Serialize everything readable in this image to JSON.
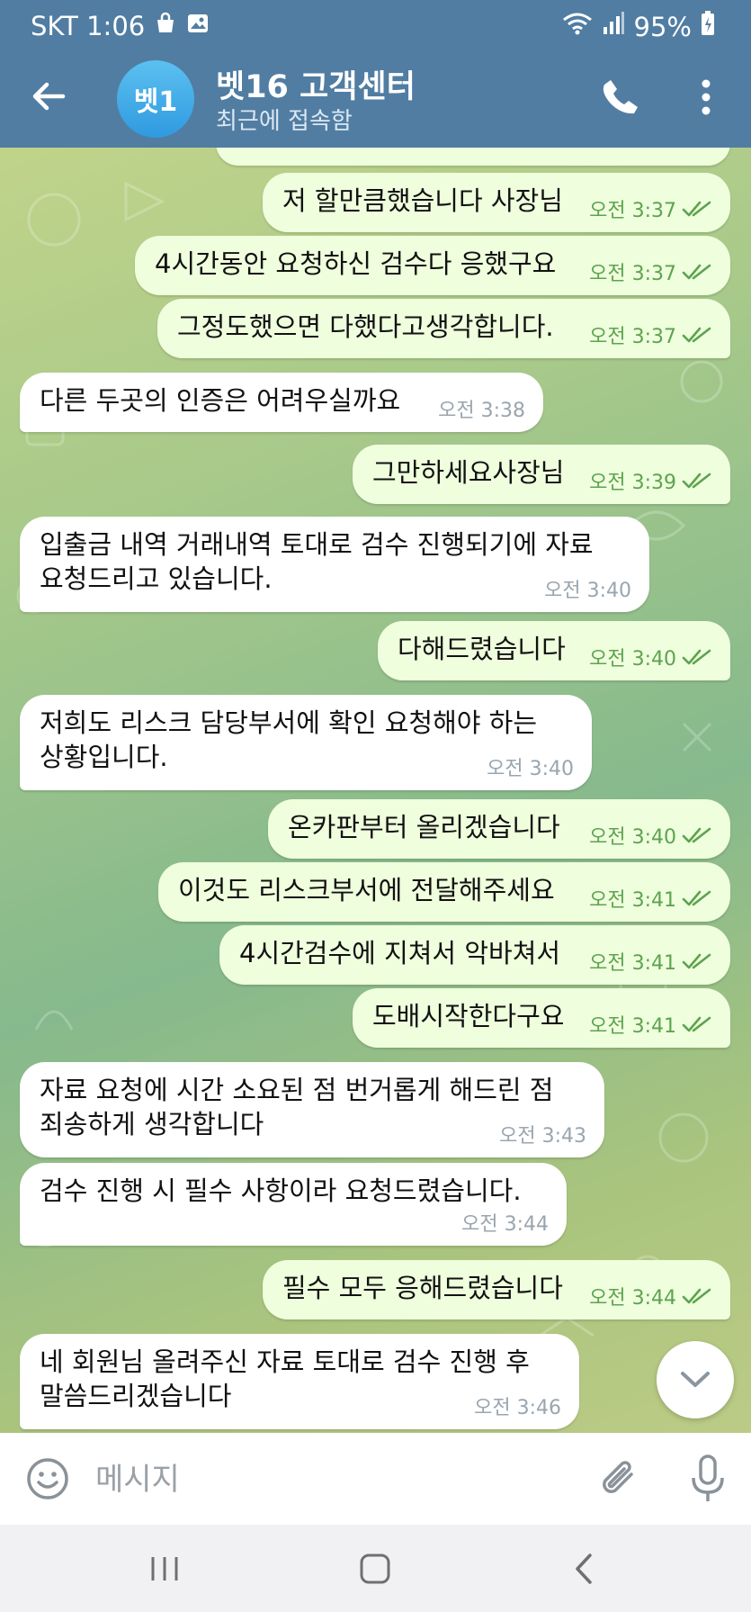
{
  "status_bar": {
    "carrier_time": "SKT 1:06",
    "battery": "95%"
  },
  "header": {
    "avatar_text": "벳1",
    "title": "벳16 고객센터",
    "subtitle": "최근에 접속함"
  },
  "messages": [
    {
      "dir": "out",
      "text": "저 할만큼했습니다 사장님",
      "time": "오전 3:37"
    },
    {
      "dir": "out",
      "text": "4시간동안 요청하신 검수다 응했구요",
      "time": "오전 3:37"
    },
    {
      "dir": "out",
      "text": "그정도했으면 다했다고생각합니다.",
      "time": "오전 3:37"
    },
    {
      "dir": "in",
      "text": "다른 두곳의 인증은 어려우실까요",
      "time": "오전 3:38"
    },
    {
      "dir": "out",
      "text": "그만하세요사장님",
      "time": "오전 3:39"
    },
    {
      "dir": "in",
      "text": "입출금 내역 거래내역 토대로 검수 진행되기에 자료\n요청드리고 있습니다.",
      "time": "오전 3:40"
    },
    {
      "dir": "out",
      "text": "다해드렸습니다",
      "time": "오전 3:40"
    },
    {
      "dir": "in",
      "text": "저희도 리스크 담당부서에 확인 요청해야 하는\n상황입니다.",
      "time": "오전 3:40"
    },
    {
      "dir": "out",
      "text": "온카판부터 올리겠습니다",
      "time": "오전 3:40"
    },
    {
      "dir": "out",
      "text": "이것도 리스크부서에 전달해주세요",
      "time": "오전 3:41"
    },
    {
      "dir": "out",
      "text": "4시간검수에 지쳐서 악바쳐서",
      "time": "오전 3:41"
    },
    {
      "dir": "out",
      "text": "도배시작한다구요",
      "time": "오전 3:41"
    },
    {
      "dir": "in",
      "text": "자료 요청에 시간 소요된 점 번거롭게 해드린 점\n죄송하게 생각합니다",
      "time": "오전 3:43"
    },
    {
      "dir": "in",
      "text": "검수 진행 시 필수 사항이라 요청드렸습니다.",
      "time": "오전 3:44"
    },
    {
      "dir": "out",
      "text": "필수 모두 응해드렸습니다",
      "time": "오전 3:44"
    },
    {
      "dir": "in",
      "text": "네 회원님 올려주신 자료 토대로 검수 진행 후\n말씀드리겠습니다",
      "time": "오전 3:46"
    }
  ],
  "input": {
    "placeholder": "메시지"
  },
  "colors": {
    "header": "#517da2",
    "outgoing_bubble": "#effedd",
    "incoming_bubble": "#ffffff",
    "read_check": "#5da34f"
  },
  "icons": [
    "back-arrow-icon",
    "phone-icon",
    "more-vert-icon",
    "emoji-icon",
    "paperclip-icon",
    "mic-icon",
    "chevron-down-icon",
    "recent-apps-icon",
    "home-icon",
    "nav-back-icon",
    "wifi-icon",
    "signal-icon",
    "battery-icon",
    "shopping-bag-icon",
    "gallery-icon"
  ]
}
